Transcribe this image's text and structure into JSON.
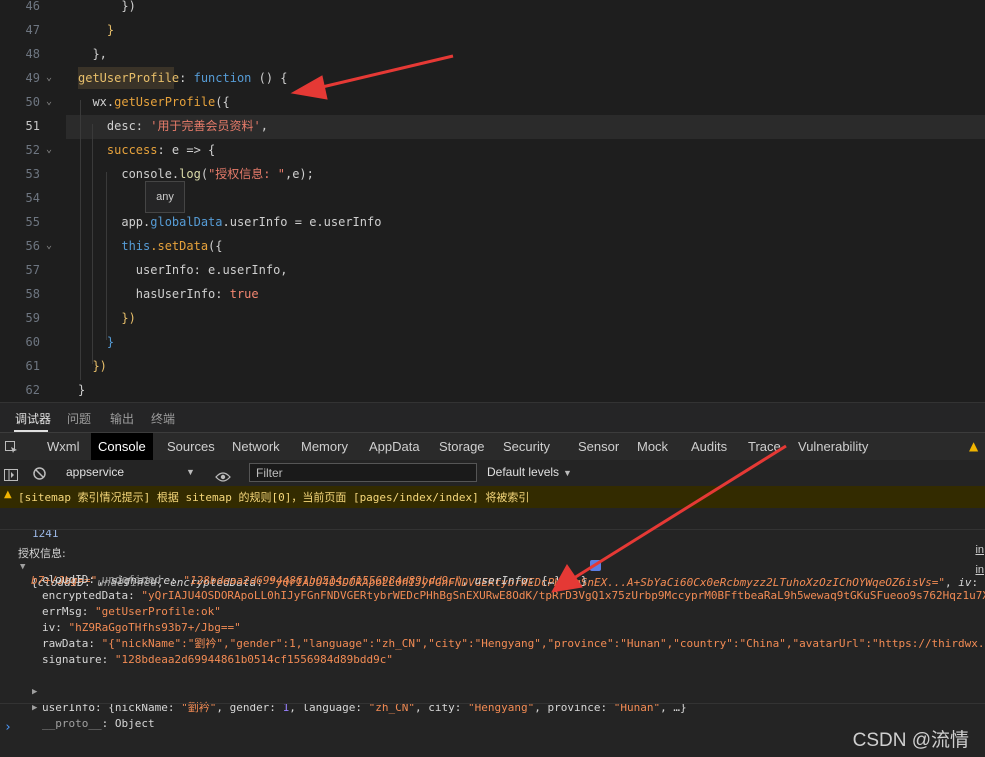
{
  "editor": {
    "tooltip": "any",
    "lines": [
      {
        "n": "46",
        "segments": [
          {
            "t": "      })",
            "c": "k-prop"
          }
        ]
      },
      {
        "n": "47",
        "segments": [
          {
            "t": "    }",
            "c": "k-yellow"
          }
        ]
      },
      {
        "n": "48",
        "segments": [
          {
            "t": "  },",
            "c": "k-prop"
          }
        ]
      },
      {
        "n": "49",
        "segments": [
          {
            "t": "getUserProfile",
            "c": "k-yellow"
          },
          {
            "t": ": ",
            "c": "k-prop"
          },
          {
            "t": "function",
            "c": "k-blue"
          },
          {
            "t": " () {",
            "c": "k-prop"
          }
        ]
      },
      {
        "n": "50",
        "segments": [
          {
            "t": "  wx.",
            "c": "k-prop"
          },
          {
            "t": "getUserProfile",
            "c": "k-orange"
          },
          {
            "t": "({",
            "c": "k-prop"
          }
        ]
      },
      {
        "n": "51",
        "segments": [
          {
            "t": "    desc: ",
            "c": "k-prop"
          },
          {
            "t": "'用于完善会员资料'",
            "c": "k-str"
          },
          {
            "t": ",",
            "c": "k-prop"
          }
        ]
      },
      {
        "n": "52",
        "segments": [
          {
            "t": "    success",
            "c": "k-orange"
          },
          {
            "t": ": e => {",
            "c": "k-prop"
          }
        ]
      },
      {
        "n": "53",
        "segments": [
          {
            "t": "      console.",
            "c": "k-prop"
          },
          {
            "t": "log",
            "c": "k-fn"
          },
          {
            "t": "(",
            "c": "k-prop"
          },
          {
            "t": "\"授权信息: \"",
            "c": "k-str"
          },
          {
            "t": ",e);",
            "c": "k-prop"
          }
        ]
      },
      {
        "n": "54",
        "segments": []
      },
      {
        "n": "55",
        "segments": [
          {
            "t": "      app.",
            "c": "k-prop"
          },
          {
            "t": "globalData",
            "c": "k-blue"
          },
          {
            "t": ".userInfo = e.userInfo",
            "c": "k-prop"
          }
        ]
      },
      {
        "n": "56",
        "segments": [
          {
            "t": "      this",
            "c": "k-blue"
          },
          {
            "t": ".setData",
            "c": "k-orange"
          },
          {
            "t": "({",
            "c": "k-prop"
          }
        ]
      },
      {
        "n": "57",
        "segments": [
          {
            "t": "        userInfo: e.userInfo,",
            "c": "k-prop"
          }
        ]
      },
      {
        "n": "58",
        "segments": [
          {
            "t": "        hasUserInfo: ",
            "c": "k-prop"
          },
          {
            "t": "true",
            "c": "k-red"
          }
        ]
      },
      {
        "n": "59",
        "segments": [
          {
            "t": "      })",
            "c": "k-yellow"
          }
        ]
      },
      {
        "n": "60",
        "segments": [
          {
            "t": "    }",
            "c": "k-blue"
          }
        ]
      },
      {
        "n": "61",
        "segments": [
          {
            "t": "  })",
            "c": "k-yellow"
          }
        ]
      },
      {
        "n": "62",
        "segments": [
          {
            "t": "}",
            "c": "k-prop"
          }
        ]
      }
    ]
  },
  "bottom_tabs": [
    "调试器",
    "问题",
    "输出",
    "终端"
  ],
  "devtools_tabs": [
    "Wxml",
    "Console",
    "Sources",
    "Network",
    "Memory",
    "AppData",
    "Storage",
    "Security",
    "Sensor",
    "Mock",
    "Audits",
    "Trace",
    "Vulnerability"
  ],
  "active_devtools_tab": "Console",
  "console_toolbar": {
    "context": "appservice",
    "filter_placeholder": "Filter",
    "levels": "Default levels"
  },
  "warning": "[sitemap 索引情况提示] 根据 sitemap 的规则[0]，当前页面 [pages/index/index] 将被索引",
  "console": {
    "count": "1241",
    "link_text": "in",
    "log_label": "授权信息:",
    "object_summary": [
      {
        "t": "{",
        "c": "c-key"
      },
      {
        "t": "cloudID",
        "c": "c-key c-it"
      },
      {
        "t": ": ",
        "c": "c-key"
      },
      {
        "t": "undefined",
        "c": "c-undef c-it"
      },
      {
        "t": ", ",
        "c": "c-key"
      },
      {
        "t": "encryptedData",
        "c": "c-key c-it"
      },
      {
        "t": ": ",
        "c": "c-key"
      },
      {
        "t": "\"yQrIAJU4OSDORApoLL0hIJyFGnFNDVGERtybrWEDcPHhBgSnEX...A+SbYaCi60Cx0eRcbmyzz2LTuhoXzOzIChOYWqeOZ6isVs=\"",
        "c": "c-str-it"
      },
      {
        "t": ", ",
        "c": "c-key"
      },
      {
        "t": "iv",
        "c": "c-key c-it"
      },
      {
        "t": ": \"",
        "c": "c-key"
      }
    ],
    "object_summary2": [
      {
        "t": "b7+/Jbg==\"",
        "c": "c-str-it"
      },
      {
        "t": ", ",
        "c": "c-key"
      },
      {
        "t": "signature",
        "c": "c-key c-it"
      },
      {
        "t": ": ",
        "c": "c-key"
      },
      {
        "t": "\"128bdeaa2d69944861b0514cf1556984d89bdd9c\"",
        "c": "c-str-it"
      },
      {
        "t": ", ",
        "c": "c-key"
      },
      {
        "t": "userInfo",
        "c": "c-key c-it"
      },
      {
        "t": ": {…}, …}",
        "c": "c-key"
      }
    ],
    "props": [
      [
        {
          "t": "cloudID",
          "c": "c-key"
        },
        {
          "t": ": ",
          "c": "c-key"
        },
        {
          "t": "undefined",
          "c": "c-undef"
        }
      ],
      [
        {
          "t": "encryptedData",
          "c": "c-key"
        },
        {
          "t": ": ",
          "c": "c-key"
        },
        {
          "t": "\"yQrIAJU4OSDORApoLL0hIJyFGnFNDVGERtybrWEDcPHhBgSnEXURwE8OdK/tpRrD3VgQ1x75zUrbp9MccyprM0BFftbeaRaL9h5wewaq9tGKuSFueoo9s762Hqz1u7X",
          "c": "c-str"
        }
      ],
      [
        {
          "t": "errMsg",
          "c": "c-key"
        },
        {
          "t": ": ",
          "c": "c-key"
        },
        {
          "t": "\"getUserProfile:ok\"",
          "c": "c-str"
        }
      ],
      [
        {
          "t": "iv",
          "c": "c-key"
        },
        {
          "t": ": ",
          "c": "c-key"
        },
        {
          "t": "\"hZ9RaGgoTHfhs93b7+/Jbg==\"",
          "c": "c-str"
        }
      ],
      [
        {
          "t": "rawData",
          "c": "c-key"
        },
        {
          "t": ": ",
          "c": "c-key"
        },
        {
          "t": "\"{\"nickName\":\"劉衿\",\"gender\":1,\"language\":\"zh_CN\",\"city\":\"Hengyang\",\"province\":\"Hunan\",\"country\":\"China\",\"avatarUrl\":\"https://thirdwx.q",
          "c": "c-str"
        }
      ],
      [
        {
          "t": "signature",
          "c": "c-key"
        },
        {
          "t": ": ",
          "c": "c-key"
        },
        {
          "t": "\"128bdeaa2d69944861b0514cf1556984d89bdd9c\"",
          "c": "c-str"
        }
      ]
    ],
    "userinfo_row": [
      {
        "t": "userInfo",
        "c": "c-key"
      },
      {
        "t": ": {nickName: ",
        "c": "c-key"
      },
      {
        "t": "\"劉衿\"",
        "c": "c-str"
      },
      {
        "t": ", gender: ",
        "c": "c-key"
      },
      {
        "t": "1",
        "c": "c-num"
      },
      {
        "t": ", language: ",
        "c": "c-key"
      },
      {
        "t": "\"zh_CN\"",
        "c": "c-str"
      },
      {
        "t": ", city: ",
        "c": "c-key"
      },
      {
        "t": "\"Hengyang\"",
        "c": "c-str"
      },
      {
        "t": ", province: ",
        "c": "c-key"
      },
      {
        "t": "\"Hunan\"",
        "c": "c-str"
      },
      {
        "t": ", …}",
        "c": "c-key"
      }
    ],
    "proto_row": [
      {
        "t": "__proto__",
        "c": "c-undef"
      },
      {
        "t": ": Object",
        "c": "c-key"
      }
    ],
    "prompt": "›"
  },
  "watermark": "CSDN @流情",
  "colors": {
    "arrow": "#e53935",
    "warning_bg": "#332b00"
  }
}
